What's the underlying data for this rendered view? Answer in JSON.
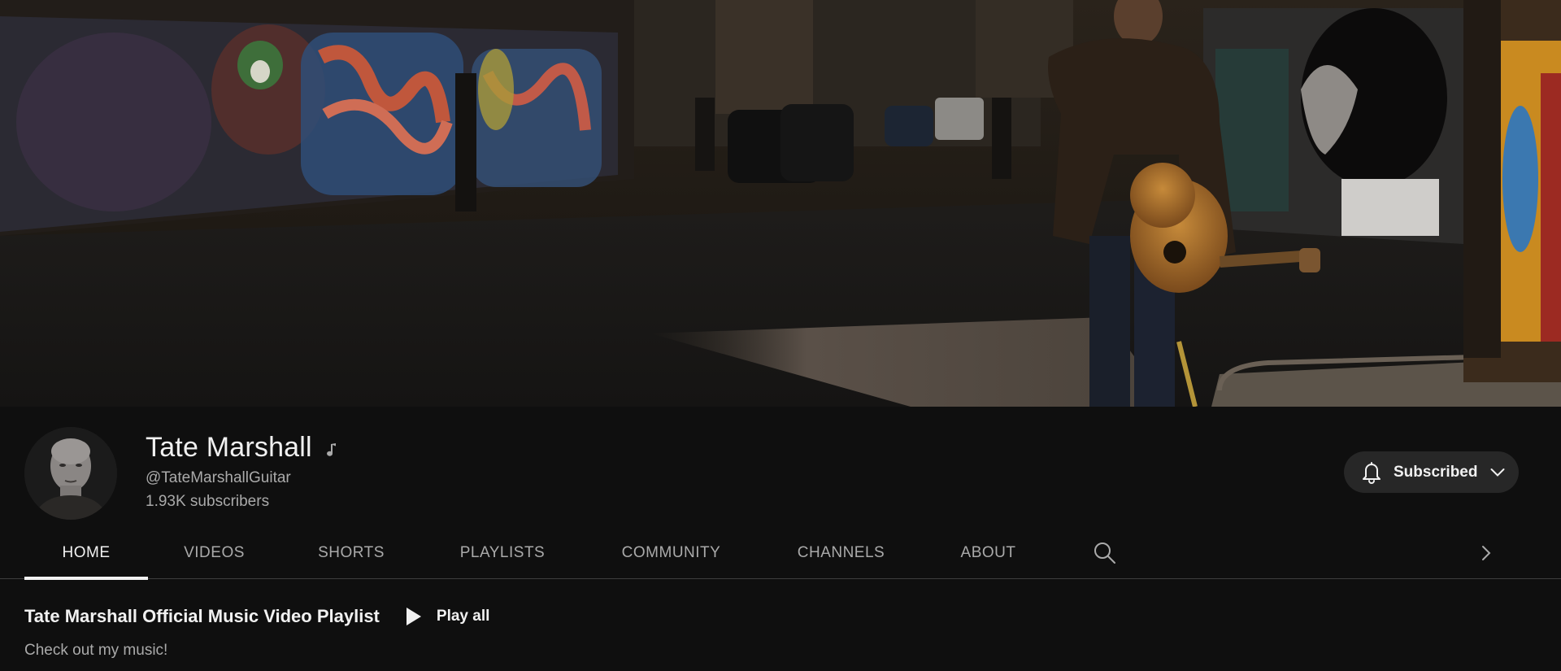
{
  "channel": {
    "name": "Tate Marshall",
    "handle": "@TateMarshallGuitar",
    "subscribers": "1.93K subscribers",
    "subscribe_label": "Subscribed"
  },
  "tabs": [
    {
      "label": "HOME",
      "active": true
    },
    {
      "label": "VIDEOS",
      "active": false
    },
    {
      "label": "SHORTS",
      "active": false
    },
    {
      "label": "PLAYLISTS",
      "active": false
    },
    {
      "label": "COMMUNITY",
      "active": false
    },
    {
      "label": "CHANNELS",
      "active": false
    },
    {
      "label": "ABOUT",
      "active": false
    }
  ],
  "section": {
    "title": "Tate Marshall Official Music Video Playlist",
    "play_all_label": "Play all",
    "description": "Check out my music!"
  },
  "icons": {
    "verified_artist": "music-note-icon",
    "subscribe_bell": "bell-icon",
    "subscribe_menu": "chevron-down-icon",
    "tab_search": "search-icon",
    "tab_scroll": "chevron-right-icon",
    "play_all": "play-icon"
  },
  "colors": {
    "background": "#0f0f0f",
    "text_primary": "#f1f1f1",
    "text_secondary": "#aaaaaa",
    "button_bg": "#272727",
    "divider": "#3d3d3d"
  }
}
